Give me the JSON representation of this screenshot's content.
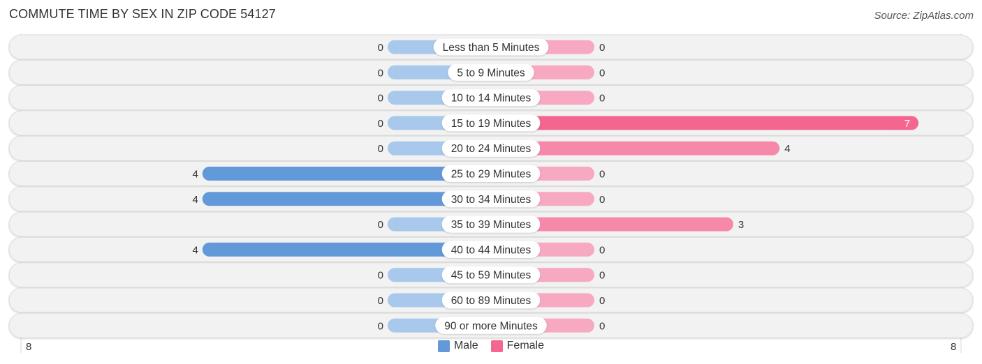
{
  "header": {
    "title": "COMMUTE TIME BY SEX IN ZIP CODE 54127",
    "source": "Source: ZipAtlas.com"
  },
  "colors": {
    "male": "#6199d9",
    "male_light": "#a8c8ec",
    "female": "#f46690",
    "female_mid": "#f689aa",
    "female_light": "#f6a9c0",
    "track": "#f2f2f2"
  },
  "chart_data": {
    "type": "bar",
    "orientation": "horizontal-diverging",
    "title": "COMMUTE TIME BY SEX IN ZIP CODE 54127",
    "categories": [
      "Less than 5 Minutes",
      "5 to 9 Minutes",
      "10 to 14 Minutes",
      "15 to 19 Minutes",
      "20 to 24 Minutes",
      "25 to 29 Minutes",
      "30 to 34 Minutes",
      "35 to 39 Minutes",
      "40 to 44 Minutes",
      "45 to 59 Minutes",
      "60 to 89 Minutes",
      "90 or more Minutes"
    ],
    "series": [
      {
        "name": "Male",
        "values": [
          0,
          0,
          0,
          0,
          0,
          4,
          4,
          0,
          4,
          0,
          0,
          0
        ]
      },
      {
        "name": "Female",
        "values": [
          0,
          0,
          0,
          7,
          4,
          0,
          0,
          3,
          0,
          0,
          0,
          0
        ]
      }
    ],
    "axis": {
      "left_label": "8",
      "right_label": "8",
      "range": [
        8,
        8
      ]
    },
    "legend": {
      "placement": "bottom-center",
      "entries": [
        "Male",
        "Female"
      ]
    }
  }
}
